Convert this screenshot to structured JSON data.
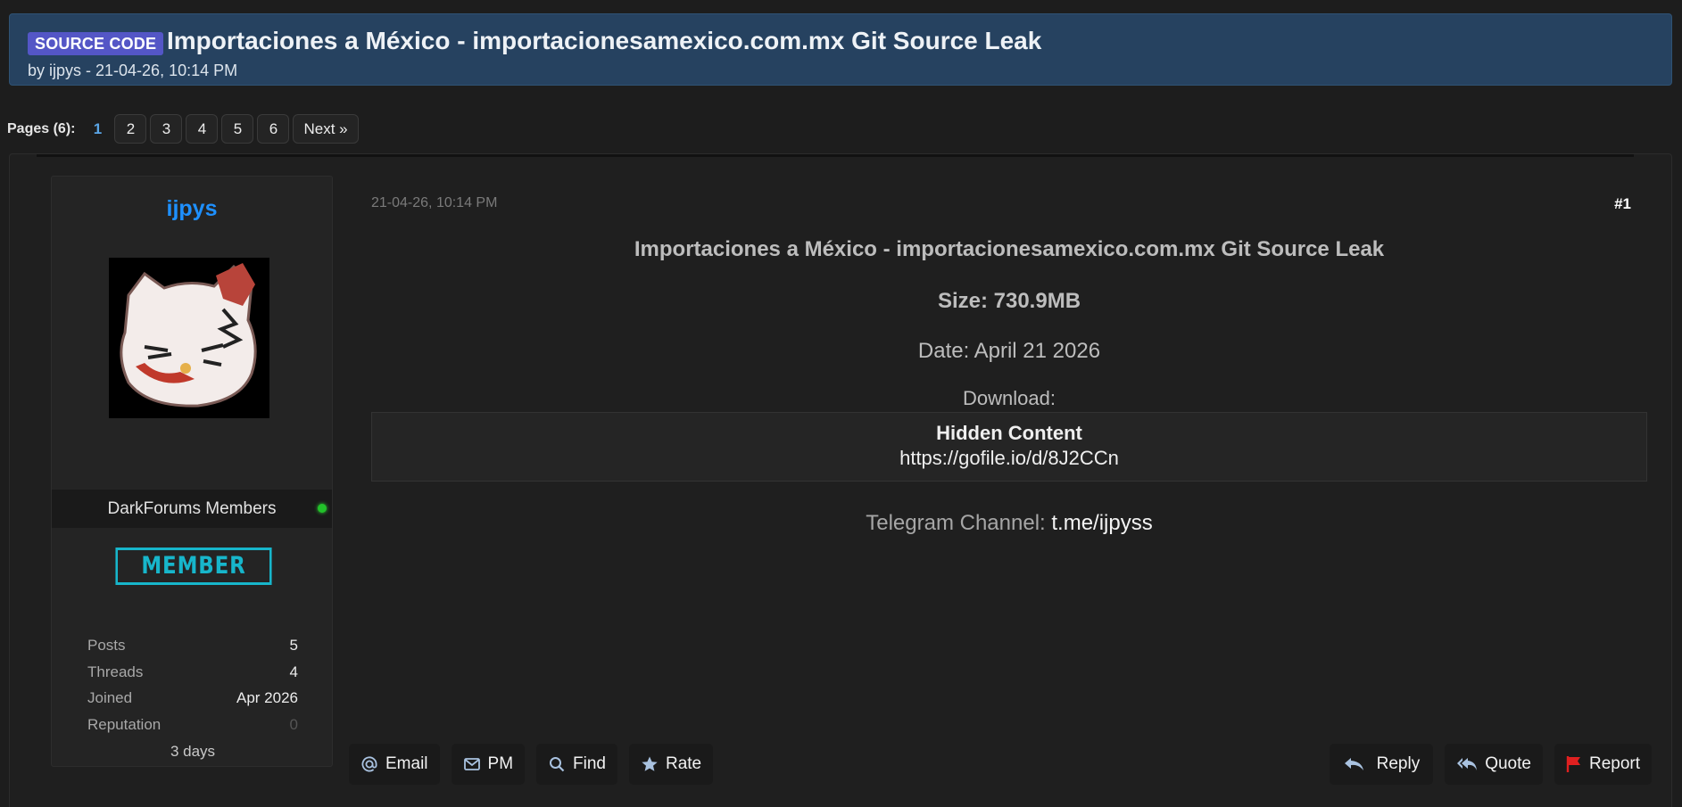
{
  "thread": {
    "badge": "SOURCE CODE",
    "title": "Importaciones a México - importacionesamexico.com.mx Git Source Leak",
    "byline": "by ijpys - 21-04-26, 10:14 PM"
  },
  "pagination": {
    "label": "Pages (6):",
    "current": "1",
    "pages": [
      "2",
      "3",
      "4",
      "5",
      "6"
    ],
    "next": "Next »"
  },
  "author": {
    "username": "ijpys",
    "usergroup": "DarkForums Members",
    "rank": "MEMBER",
    "stats": [
      {
        "label": "Posts",
        "value": "5"
      },
      {
        "label": "Threads",
        "value": "4"
      },
      {
        "label": "Joined",
        "value": "Apr 2026"
      },
      {
        "label": "Reputation",
        "value": "0"
      }
    ],
    "time_online": "3 days",
    "colors": {
      "username": "#1e90ff",
      "online": "#22c22a",
      "rank": "#17b6cb"
    }
  },
  "post": {
    "date": "21-04-26, 10:14 PM",
    "number": "#1",
    "title": "Importaciones a México - importacionesamexico.com.mx Git Source Leak",
    "size": "Size: 730.9MB",
    "date_line": "Date: April 21 2026",
    "download_label": "Download:",
    "hidden_title": "Hidden Content",
    "hidden_link": "https://gofile.io/d/8J2CCn",
    "telegram_label": "Telegram Channel: ",
    "telegram_link": "t.me/ijpyss"
  },
  "actions": {
    "left": [
      {
        "label": "Email",
        "icon": "at-icon"
      },
      {
        "label": "PM",
        "icon": "envelope-icon"
      },
      {
        "label": "Find",
        "icon": "search-icon"
      },
      {
        "label": "Rate",
        "icon": "star-icon"
      }
    ],
    "right": [
      {
        "label": "Reply",
        "icon": "reply-icon"
      },
      {
        "label": "Quote",
        "icon": "reply-all-icon"
      },
      {
        "label": "Report",
        "icon": "flag-icon"
      }
    ]
  }
}
